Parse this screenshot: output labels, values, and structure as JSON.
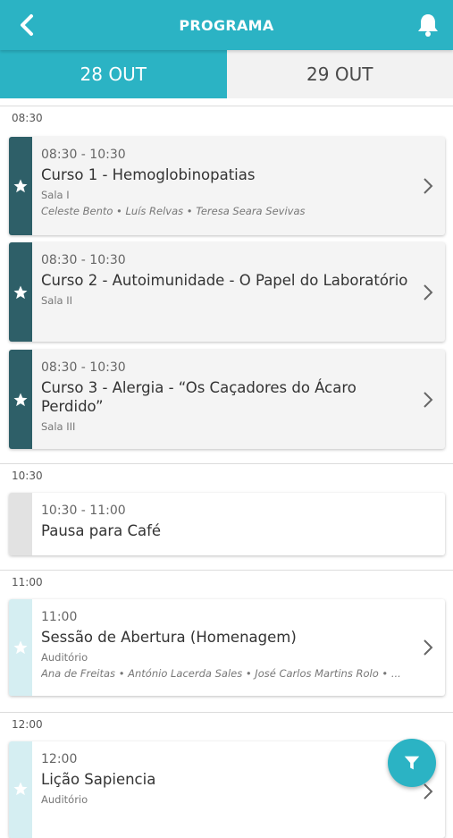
{
  "header": {
    "title": "PROGRAMA",
    "back_icon": "chevron-left-icon",
    "bell_icon": "bell-icon"
  },
  "tabs": [
    {
      "label": "28 OUT",
      "active": true
    },
    {
      "label": "29 OUT",
      "active": false
    }
  ],
  "sections": [
    {
      "time": "08:30"
    },
    {
      "time": "10:30"
    },
    {
      "time": "11:00"
    },
    {
      "time": "12:00"
    }
  ],
  "sessions": [
    {
      "time": "08:30 - 10:30",
      "title": "Curso 1 - Hemoglobinopatias",
      "room": "Sala I",
      "speakers": "Celeste Bento • Luís Relvas • Teresa Seara Sevivas",
      "favorite": true
    },
    {
      "time": "08:30 - 10:30",
      "title": "Curso 2 - Autoimunidade - O Papel do Laboratório",
      "room": "Sala II",
      "favorite": true
    },
    {
      "time": "08:30 - 10:30",
      "title": "Curso 3 - Alergia - “Os Caçadores do Ácaro Perdido”",
      "room": "Sala III",
      "favorite": true
    },
    {
      "time": "10:30 - 11:00",
      "title": "Pausa para Café"
    },
    {
      "time": "11:00",
      "title": "Sessão de Abertura (Homenagem)",
      "room": "Auditório",
      "speakers": "Ana de Freitas • António Lacerda Sales • José Carlos Martins Rolo • ...",
      "favorite": false
    },
    {
      "time": "12:00",
      "title": "Lição Sapiencia",
      "room": "Auditório",
      "favorite": false
    }
  ],
  "colors": {
    "primary": "#2bb3c4",
    "favorite_bar": "#2e5f68",
    "unfav_bar": "#d5eef2"
  },
  "fab": {
    "icon": "filter-icon"
  }
}
